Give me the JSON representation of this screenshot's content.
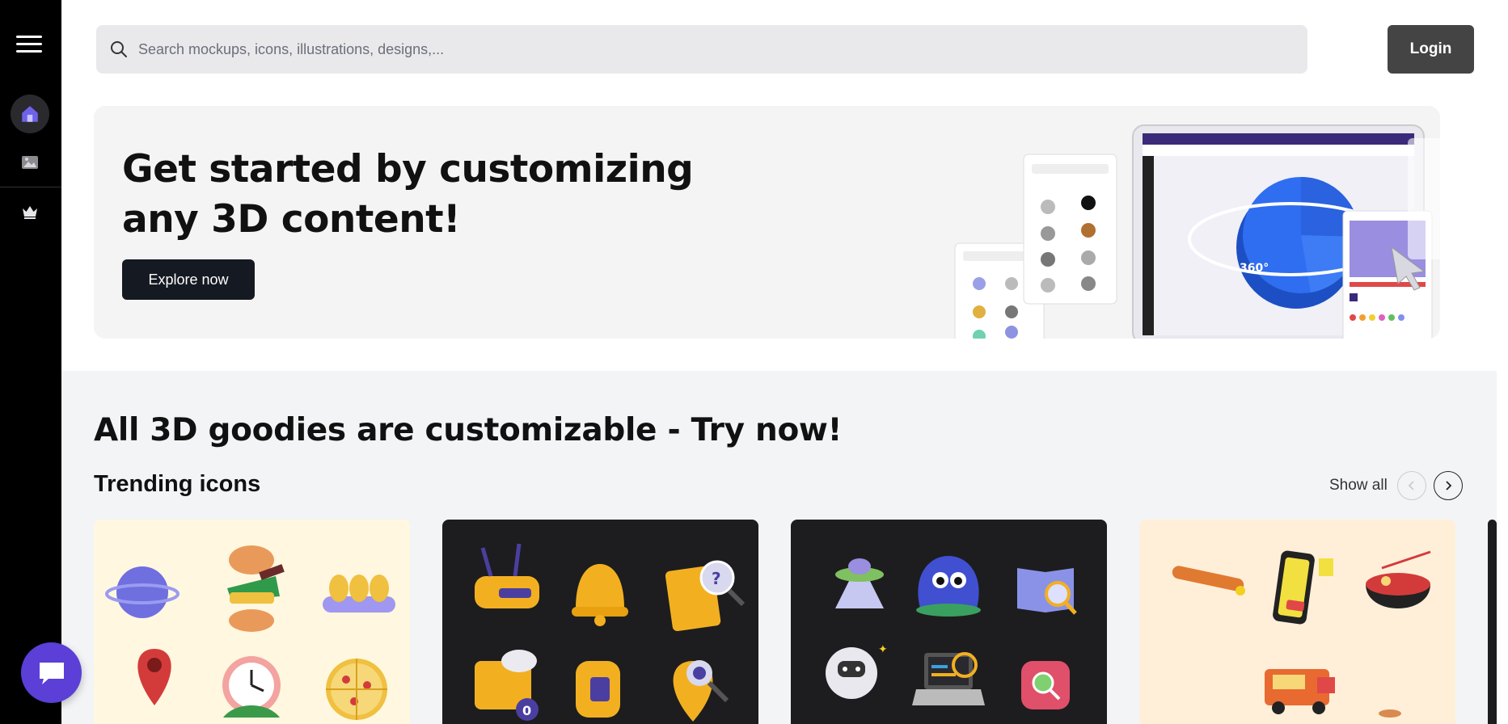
{
  "search": {
    "placeholder": "Search mockups, icons, illustrations, designs,..."
  },
  "header": {
    "login_label": "Login"
  },
  "sidebar": {
    "items": [
      {
        "icon": "home-icon"
      },
      {
        "icon": "image-icon"
      },
      {
        "icon": "crown-icon"
      }
    ]
  },
  "hero": {
    "title": "Get started by customizing any 3D content!",
    "button_label": "Explore now",
    "rotation_label": "360°"
  },
  "section": {
    "title": "All 3D goodies are customizable - Try now!",
    "trending_title": "Trending icons",
    "show_all_label": "Show all"
  },
  "cards": [
    {
      "background": "#fff7df",
      "icons": [
        "planet-icon",
        "burger-icon",
        "eggs-icon",
        "location-pin-icon",
        "clock-icon",
        "pizza-icon"
      ]
    },
    {
      "background": "#1d1d1f",
      "icons": [
        "router-icon",
        "bell-icon",
        "document-search-icon",
        "cloud-folder-icon",
        "mailbox-icon",
        "location-search-icon"
      ]
    },
    {
      "background": "#1d1d1f",
      "icons": [
        "ufo-icon",
        "monster-icon",
        "book-search-icon",
        "robot-icon",
        "laptop-search-icon",
        "search-badge-icon"
      ]
    },
    {
      "background": "#ffefd9",
      "icons": [
        "skateboard-icon",
        "smartphone-icon",
        "ramen-icon",
        "food-truck-icon"
      ]
    }
  ],
  "colors": {
    "accent": "#5b3fd6",
    "sidebar": "#000000",
    "hero_button": "#151922",
    "login_button": "#444444"
  }
}
